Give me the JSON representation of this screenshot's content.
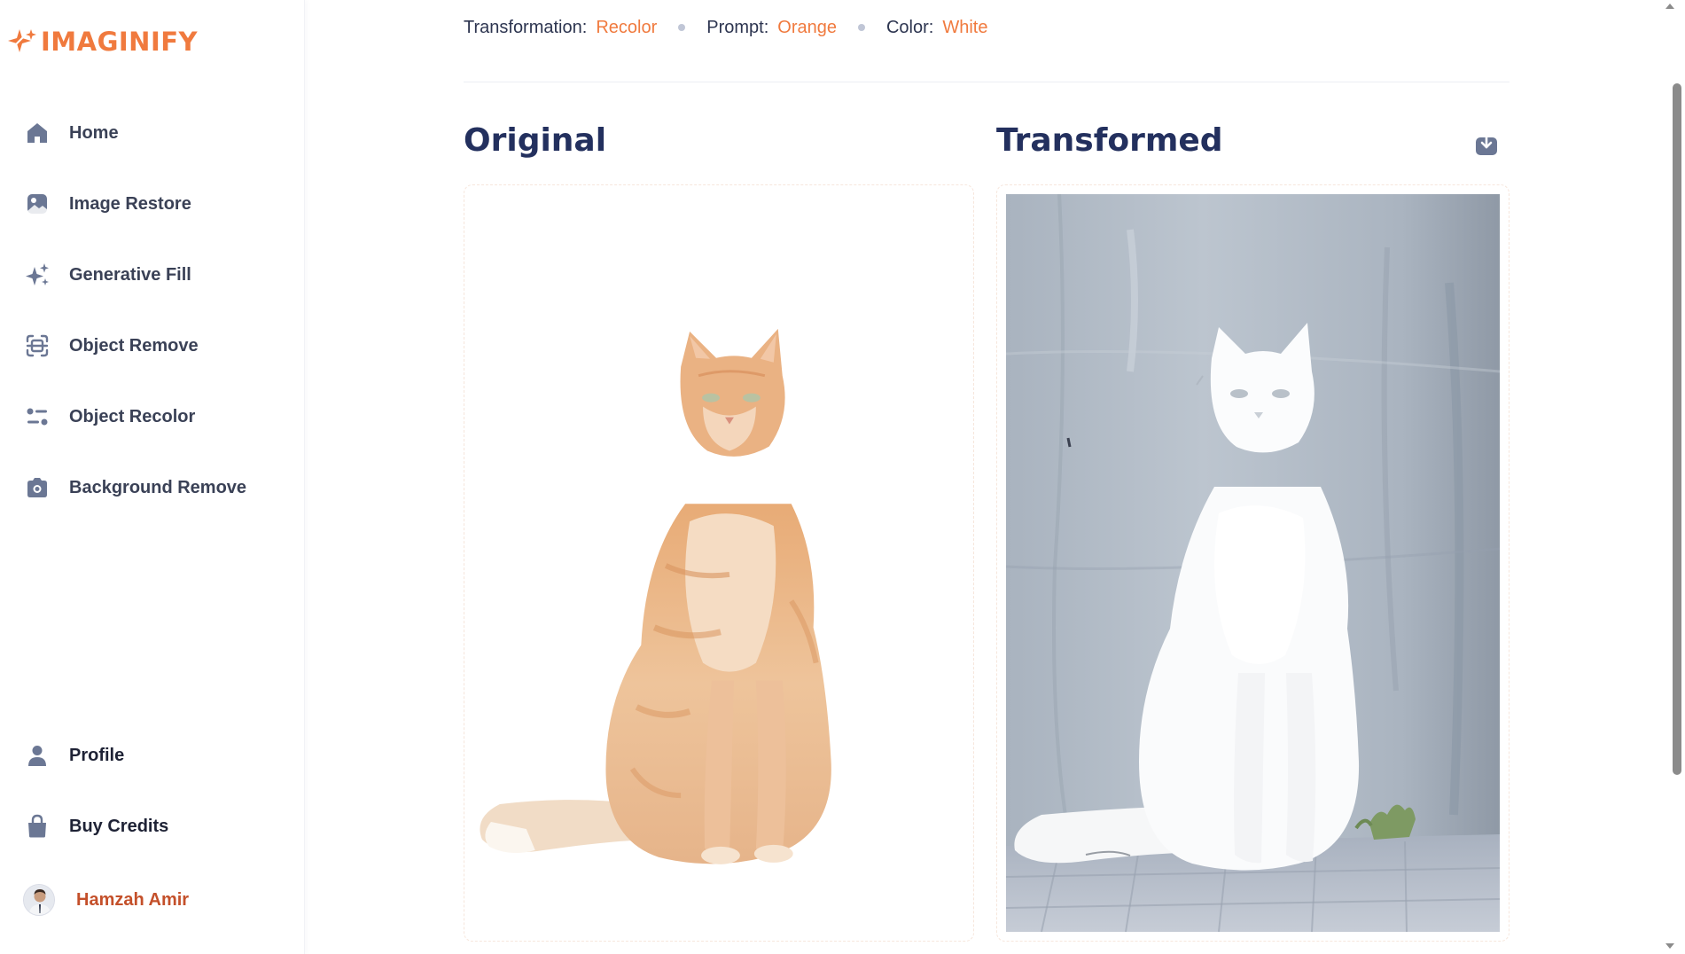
{
  "app": {
    "name": "IMAGINIFY",
    "brand_color": "#f07a3e"
  },
  "sidebar": {
    "items": [
      {
        "label": "Home",
        "icon": "home-icon"
      },
      {
        "label": "Image Restore",
        "icon": "image-icon"
      },
      {
        "label": "Generative Fill",
        "icon": "sparkles-icon"
      },
      {
        "label": "Object Remove",
        "icon": "scan-icon"
      },
      {
        "label": "Object Recolor",
        "icon": "filter-icon"
      },
      {
        "label": "Background Remove",
        "icon": "camera-icon"
      }
    ],
    "bottom_items": [
      {
        "label": "Profile",
        "icon": "user-icon"
      },
      {
        "label": "Buy Credits",
        "icon": "bag-icon"
      }
    ],
    "user": {
      "name": "Hamzah Amir"
    }
  },
  "details": {
    "transformation_label": "Transformation:",
    "transformation_value": "Recolor",
    "prompt_label": "Prompt:",
    "prompt_value": "Orange",
    "color_label": "Color:",
    "color_value": "White"
  },
  "panels": {
    "original_title": "Original",
    "transformed_title": "Transformed"
  },
  "colors": {
    "accent": "#f07a3e",
    "heading": "#23305e",
    "icon": "#6b7794"
  }
}
